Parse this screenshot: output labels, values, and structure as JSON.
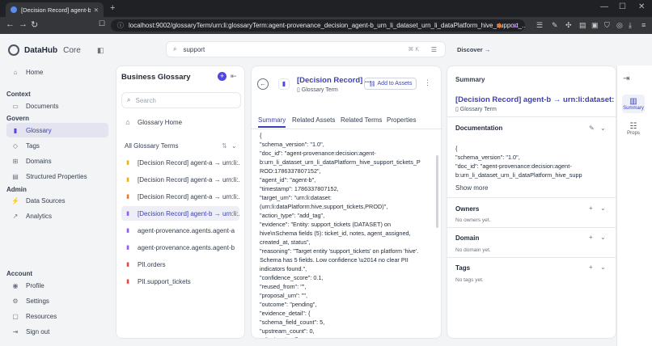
{
  "browser": {
    "tab_title": "[Decision Record] agent-b → urn:l",
    "url": "localhost:9002/glossaryTerm/urn:li:glossaryTerm:agent-provenance_decision_agent-b_urn_li_dataset_urn_li_dataPlatform_hive_support_..."
  },
  "app": {
    "name": "DataHub",
    "edition": "Core",
    "search_value": "support",
    "search_shortcut": "⌘ K",
    "discover_label": "Discover →"
  },
  "nav": {
    "home": "Home",
    "context_header": "Context",
    "documents": "Documents",
    "govern_header": "Govern",
    "glossary": "Glossary",
    "tags": "Tags",
    "domains": "Domains",
    "structured_properties": "Structured Properties",
    "admin_header": "Admin",
    "data_sources": "Data Sources",
    "analytics": "Analytics",
    "account_header": "Account",
    "profile": "Profile",
    "settings": "Settings",
    "resources": "Resources",
    "sign_out": "Sign out"
  },
  "glossary": {
    "title": "Business Glossary",
    "search_placeholder": "Search",
    "home_label": "Glossary Home",
    "all_terms_label": "All Glossary Terms",
    "items": [
      {
        "label": "[Decision Record] agent-a → urn:li:...",
        "color": "#eab308"
      },
      {
        "label": "[Decision Record] agent-a → urn:li:...",
        "color": "#eab308"
      },
      {
        "label": "[Decision Record] agent-a → urn:li:...",
        "color": "#f97316"
      },
      {
        "label": "[Decision Record] agent-b → urn:li:...",
        "color": "#8b5cf6"
      },
      {
        "label": "agent-provenance.agents.agent-a",
        "color": "#8b5cf6"
      },
      {
        "label": "agent-provenance.agents.agent-b",
        "color": "#8b5cf6"
      },
      {
        "label": "PII.orders",
        "color": "#ef4444"
      },
      {
        "label": "PII.support_tickets",
        "color": "#ef4444"
      }
    ]
  },
  "entity": {
    "title": "[Decision Record] ...",
    "type": "Glossary Term",
    "add_to_assets": "Add to Assets",
    "tabs": [
      "Summary",
      "Related Assets",
      "Related Terms",
      "Properties"
    ],
    "content_lines": [
      "{",
      "\"schema_version\": \"1.0\",",
      "\"doc_id\": \"agent-provenance:decision:agent-",
      "b:urn_li_dataset_urn_li_dataPlatform_hive_support_tickets_P",
      "ROD:1786337807152\",",
      "\"agent_id\": \"agent-b\",",
      "\"timestamp\": 1786337807152,",
      "\"target_urn\": \"urn:li:dataset:",
      "(urn:li:dataPlatform:hive,support_tickets,PROD)\",",
      "\"action_type\": \"add_tag\",",
      "\"evidence\": \"Entity: support_tickets (DATASET) on",
      "hive\\nSchema fields (5): ticket_id, notes, agent_assigned,",
      "created_at, status\",",
      "\"reasoning\": \"Target entity 'support_tickets' on platform 'hive'.",
      "Schema has 5 fields. Low confidence \\u2014 no clear PII",
      "indicators found.\",",
      "\"confidence_score\": 0.1,",
      "\"reused_from\": \"\",",
      "\"proposal_urn\": \"\",",
      "\"outcome\": \"pending\",",
      "\"evidence_detail\": {",
      "\"schema_field_count\": 5,",
      "\"upstream_count\": 0,",
      "\"pii_signals\": []"
    ]
  },
  "summary": {
    "header": "Summary",
    "name": "[Decision Record] agent-b → urn:li:dataset:(urn",
    "type": "Glossary Term",
    "documentation_label": "Documentation",
    "doc_lines": [
      "{",
      "\"schema_version\": \"1.0\",",
      "\"doc_id\": \"agent-provenance:decision:agent-",
      "b:urn_li_dataset_urn_li_dataPlatform_hive_supp"
    ],
    "show_more": "Show more",
    "owners_label": "Owners",
    "owners_empty": "No owners yet.",
    "domain_label": "Domain",
    "domain_empty": "No domain yet.",
    "tags_label": "Tags",
    "tags_empty": "No tags yet."
  },
  "rail": {
    "summary": "Summary",
    "props": "Props"
  }
}
